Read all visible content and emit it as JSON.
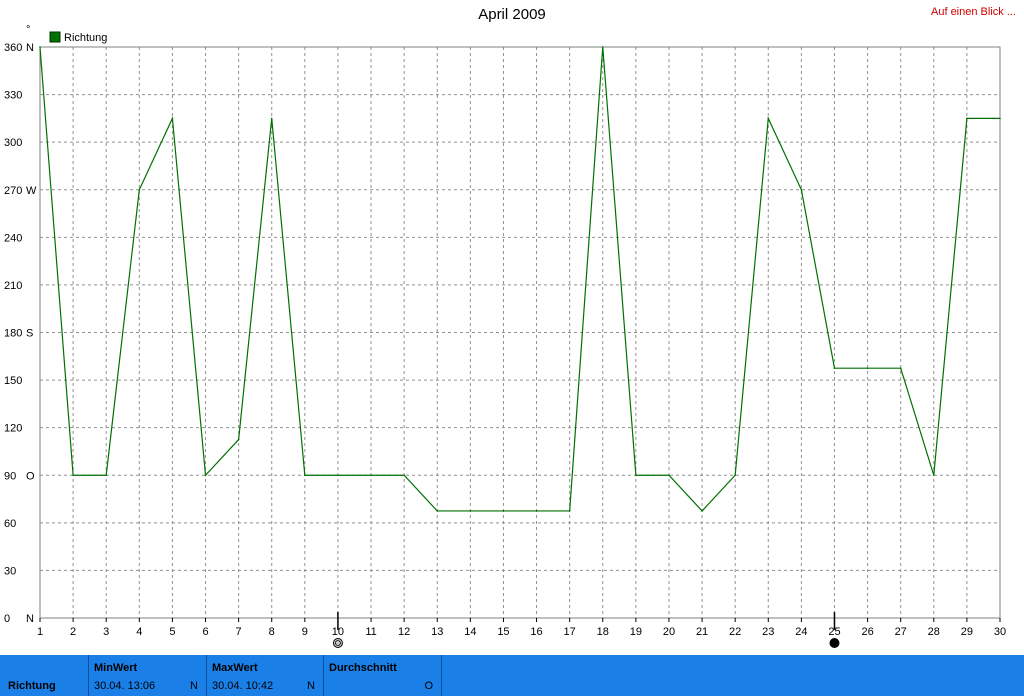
{
  "header": {
    "title": "April 2009",
    "overview_link": "Auf einen Blick ..."
  },
  "chart_data": {
    "type": "line",
    "unit_symbol": "°",
    "legend": [
      {
        "name": "Richtung",
        "color": "#007000"
      }
    ],
    "x": [
      1,
      2,
      3,
      4,
      5,
      6,
      7,
      8,
      9,
      10,
      11,
      12,
      13,
      14,
      15,
      16,
      17,
      18,
      19,
      20,
      21,
      22,
      23,
      24,
      25,
      26,
      27,
      28,
      29,
      30
    ],
    "series": [
      {
        "name": "Richtung",
        "color": "#007000",
        "values": [
          360,
          90,
          90,
          270,
          315,
          90,
          112.5,
          315,
          90,
          90,
          90,
          90,
          67.5,
          67.5,
          67.5,
          67.5,
          67.5,
          360,
          90,
          90,
          67.5,
          90,
          315,
          270,
          157.5,
          157.5,
          157.5,
          90,
          315,
          315
        ]
      }
    ],
    "ylim": [
      0,
      360
    ],
    "yticks": [
      {
        "value": 0,
        "label": "0",
        "dir": "N"
      },
      {
        "value": 30,
        "label": "30",
        "dir": ""
      },
      {
        "value": 60,
        "label": "60",
        "dir": ""
      },
      {
        "value": 90,
        "label": "90",
        "dir": "O"
      },
      {
        "value": 120,
        "label": "120",
        "dir": ""
      },
      {
        "value": 150,
        "label": "150",
        "dir": ""
      },
      {
        "value": 180,
        "label": "180",
        "dir": "S"
      },
      {
        "value": 210,
        "label": "210",
        "dir": ""
      },
      {
        "value": 240,
        "label": "240",
        "dir": ""
      },
      {
        "value": 270,
        "label": "270",
        "dir": "W"
      },
      {
        "value": 300,
        "label": "300",
        "dir": ""
      },
      {
        "value": 330,
        "label": "330",
        "dir": ""
      },
      {
        "value": 360,
        "label": "360",
        "dir": "N"
      }
    ],
    "xlim": [
      1,
      30
    ],
    "grid": true,
    "legend_position": "top-left",
    "markers": [
      {
        "x": 10,
        "type": "moon-empty"
      },
      {
        "x": 25,
        "type": "moon-filled"
      }
    ]
  },
  "footer": {
    "series_label": "Richtung",
    "min": {
      "header": "MinWert",
      "value": "30.04.  13:06",
      "dir": "N"
    },
    "max": {
      "header": "MaxWert",
      "value": "30.04.  10:42",
      "dir": "N"
    },
    "avg": {
      "header": "Durchschnitt",
      "dir": "O"
    }
  }
}
